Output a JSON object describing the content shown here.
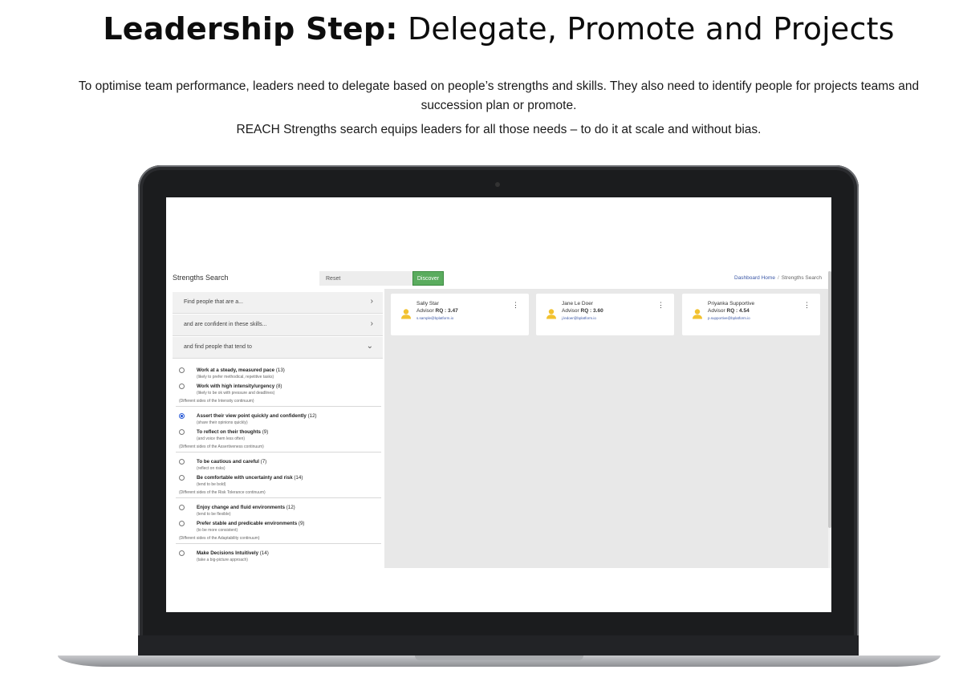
{
  "hero": {
    "title_bold": "Leadership Step:",
    "title_rest": " Delegate, Promote and Projects",
    "intro": "To optimise team performance, leaders need to delegate based on people’s strengths and skills. They also need to identify people for projects teams and succession plan or promote.",
    "intro2": "REACH Strengths search equips leaders for all those needs – to do it at scale and without bias."
  },
  "app": {
    "title": "Strengths Search",
    "reset_label": "Reset",
    "discover_label": "Discover",
    "breadcrumb": {
      "home": "Dashboard Home",
      "sep": "/",
      "current": "Strengths Search"
    },
    "filters": [
      {
        "label": "Find people that are a...",
        "icon": "chevron-right-icon",
        "glyph": "›"
      },
      {
        "label": "and are confident in these skills...",
        "icon": "chevron-right-icon",
        "glyph": "›"
      },
      {
        "label": "and find people that tend to",
        "icon": "chevron-down-icon",
        "glyph": "⌄"
      }
    ],
    "groups": [
      {
        "options": [
          {
            "label": "Work at a steady, measured pace",
            "count": " (13)",
            "hint": "(likely to prefer methodical, repetitive tasks)",
            "selected": false
          },
          {
            "label": "Work with high intensity/urgency",
            "count": " (8)",
            "hint": "(likely to be ok with pressure and deadlines)",
            "selected": false
          }
        ],
        "note": "(Different sides of the Intensity continuum)"
      },
      {
        "options": [
          {
            "label": "Assert their view point quickly and confidently",
            "count": " (12)",
            "hint": "(share their opinions quickly)",
            "selected": true
          },
          {
            "label": "To reflect on their thoughts",
            "count": " (9)",
            "hint": "(and voice them less often)",
            "selected": false
          }
        ],
        "note": "(Different sides of the Assertiveness continuum)"
      },
      {
        "options": [
          {
            "label": "To be cautious and careful",
            "count": " (7)",
            "hint": "(reflect on risks)",
            "selected": false
          },
          {
            "label": "Be comfortable with uncertainty and risk",
            "count": " (14)",
            "hint": "(tend to be bold)",
            "selected": false
          }
        ],
        "note": "(Different sides of the Risk Tolerance continuum)"
      },
      {
        "options": [
          {
            "label": "Enjoy change and fluid environments",
            "count": " (12)",
            "hint": "(tend to be flexible)",
            "selected": false
          },
          {
            "label": "Prefer stable and predicable environments",
            "count": " (9)",
            "hint": "(to be more consistent)",
            "selected": false
          }
        ],
        "note": "(Different sides of the Adaptability continuum)"
      },
      {
        "options": [
          {
            "label": "Make Decisions Intuitively",
            "count": " (14)",
            "hint": "(take a big-picture approach)",
            "selected": false
          }
        ],
        "note": ""
      }
    ],
    "results": [
      {
        "name": "Sally Star",
        "role": "Advisor",
        "rq_label": "RQ : ",
        "rq": "3.47",
        "email": "s.sample@bplatform.io"
      },
      {
        "name": "Jane Le Doer",
        "role": "Advisor",
        "rq_label": "RQ : ",
        "rq": "3.60",
        "email": "j.ledoer@bplatform.io"
      },
      {
        "name": "Priyanka Supportive",
        "role": "Advisor",
        "rq_label": "RQ : ",
        "rq": "4.54",
        "email": "p.supportive@bplatform.io"
      }
    ],
    "colors": {
      "discover": "#5aac5e",
      "link": "#3b57a6",
      "avatar": "#f2c230",
      "panel_bg": "#e8e8e8"
    }
  }
}
